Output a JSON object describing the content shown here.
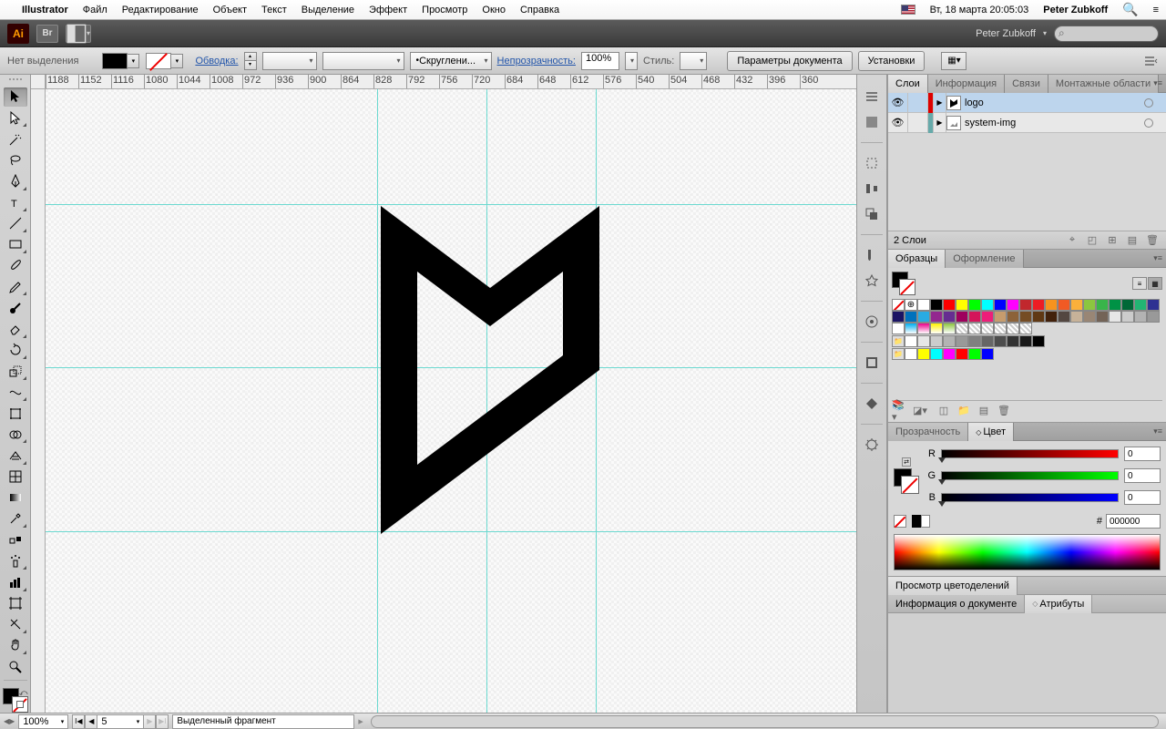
{
  "menubar": {
    "app": "Illustrator",
    "items": [
      "Файл",
      "Редактирование",
      "Объект",
      "Текст",
      "Выделение",
      "Эффект",
      "Просмотр",
      "Окно",
      "Справка"
    ],
    "datetime": "Вт, 18 марта 20:05:03",
    "username": "Peter Zubkoff"
  },
  "titlebar": {
    "user": "Peter Zubkoff"
  },
  "controlbar": {
    "selection": "Нет выделения",
    "stroke_label": "Обводка:",
    "stroke_weight": "",
    "cap_label": "Скруглени...",
    "opacity_label": "Непрозрачность:",
    "opacity": "100%",
    "style_label": "Стиль:",
    "btn_docsetup": "Параметры документа",
    "btn_prefs": "Установки"
  },
  "ruler_values": [
    1188,
    1152,
    1116,
    1080,
    1044,
    1008,
    972,
    936,
    900,
    864,
    828,
    792,
    756,
    720,
    684,
    648,
    612,
    576,
    540,
    504,
    468,
    432,
    396,
    360
  ],
  "layers": {
    "tabs": [
      "Слои",
      "Информация",
      "Связи",
      "Монтажные области"
    ],
    "items": [
      {
        "name": "logo",
        "color": "#d00"
      },
      {
        "name": "system-img",
        "color": "#6aa"
      }
    ],
    "footer_count": "2 Слои"
  },
  "swatches": {
    "tabs": [
      "Образцы",
      "Оформление"
    ],
    "row1": [
      "none",
      "reg",
      "#ffffff",
      "#000000",
      "#ff0000",
      "#ffff00",
      "#00ff00",
      "#00ffff",
      "#0000ff",
      "#ff00ff",
      "#c1272d",
      "#ed1c24",
      "#f7931e",
      "#f15a24",
      "#fbb03b",
      "#8cc63f",
      "#39b54a",
      "#009245",
      "#006837",
      "#22b573",
      "#2e3192"
    ],
    "row2": [
      "#1b1464",
      "#0071bc",
      "#29abe2",
      "#93278f",
      "#662d91",
      "#9e005d",
      "#d4145a",
      "#ed1e79",
      "#c69c6d",
      "#8c6239",
      "#754c24",
      "#603813",
      "#42210b",
      "#534741",
      "#c7b299",
      "#998675",
      "#736357",
      "#e6e6e6",
      "#cccccc",
      "#b3b3b3",
      "#999999"
    ],
    "row3_head": [
      "#fff",
      "#00aeef",
      "#ec008c",
      "#fff200",
      "#8dc63f"
    ],
    "gray_row": [
      "#ffffff",
      "#e6e6e6",
      "#cccccc",
      "#b3b3b3",
      "#999999",
      "#808080",
      "#666666",
      "#4d4d4d",
      "#333333",
      "#1a1a1a",
      "#000000"
    ],
    "bright_row": [
      "#ffffff",
      "#ffff00",
      "#00ffff",
      "#ff00ff",
      "#ff0000",
      "#00ff00",
      "#0000ff"
    ]
  },
  "color": {
    "tabs": [
      "Прозрачность",
      "Цвет"
    ],
    "r_label": "R",
    "g_label": "G",
    "b_label": "B",
    "r": "0",
    "g": "0",
    "b": "0",
    "hex": "000000"
  },
  "collapsed1": {
    "tab": "Просмотр цветоделений"
  },
  "collapsed2": {
    "tabs": [
      "Информация о документе",
      "Атрибуты"
    ]
  },
  "statusbar": {
    "zoom": "100%",
    "artboard": "5",
    "info": "Выделенный фрагмент"
  }
}
